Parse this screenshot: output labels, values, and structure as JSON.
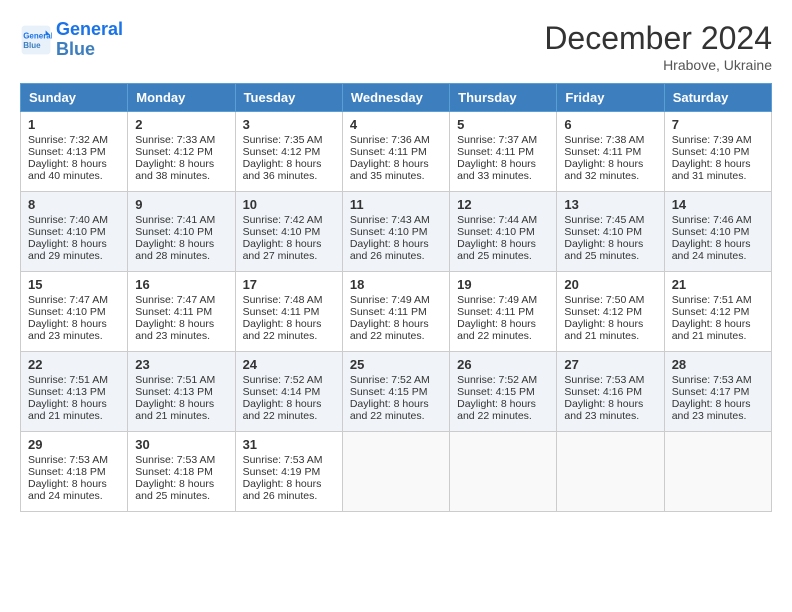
{
  "header": {
    "logo_line1": "General",
    "logo_line2": "Blue",
    "month": "December 2024",
    "location": "Hrabove, Ukraine"
  },
  "days_of_week": [
    "Sunday",
    "Monday",
    "Tuesday",
    "Wednesday",
    "Thursday",
    "Friday",
    "Saturday"
  ],
  "weeks": [
    [
      {
        "day": "1",
        "sunrise": "Sunrise: 7:32 AM",
        "sunset": "Sunset: 4:13 PM",
        "daylight": "Daylight: 8 hours and 40 minutes."
      },
      {
        "day": "2",
        "sunrise": "Sunrise: 7:33 AM",
        "sunset": "Sunset: 4:12 PM",
        "daylight": "Daylight: 8 hours and 38 minutes."
      },
      {
        "day": "3",
        "sunrise": "Sunrise: 7:35 AM",
        "sunset": "Sunset: 4:12 PM",
        "daylight": "Daylight: 8 hours and 36 minutes."
      },
      {
        "day": "4",
        "sunrise": "Sunrise: 7:36 AM",
        "sunset": "Sunset: 4:11 PM",
        "daylight": "Daylight: 8 hours and 35 minutes."
      },
      {
        "day": "5",
        "sunrise": "Sunrise: 7:37 AM",
        "sunset": "Sunset: 4:11 PM",
        "daylight": "Daylight: 8 hours and 33 minutes."
      },
      {
        "day": "6",
        "sunrise": "Sunrise: 7:38 AM",
        "sunset": "Sunset: 4:11 PM",
        "daylight": "Daylight: 8 hours and 32 minutes."
      },
      {
        "day": "7",
        "sunrise": "Sunrise: 7:39 AM",
        "sunset": "Sunset: 4:10 PM",
        "daylight": "Daylight: 8 hours and 31 minutes."
      }
    ],
    [
      {
        "day": "8",
        "sunrise": "Sunrise: 7:40 AM",
        "sunset": "Sunset: 4:10 PM",
        "daylight": "Daylight: 8 hours and 29 minutes."
      },
      {
        "day": "9",
        "sunrise": "Sunrise: 7:41 AM",
        "sunset": "Sunset: 4:10 PM",
        "daylight": "Daylight: 8 hours and 28 minutes."
      },
      {
        "day": "10",
        "sunrise": "Sunrise: 7:42 AM",
        "sunset": "Sunset: 4:10 PM",
        "daylight": "Daylight: 8 hours and 27 minutes."
      },
      {
        "day": "11",
        "sunrise": "Sunrise: 7:43 AM",
        "sunset": "Sunset: 4:10 PM",
        "daylight": "Daylight: 8 hours and 26 minutes."
      },
      {
        "day": "12",
        "sunrise": "Sunrise: 7:44 AM",
        "sunset": "Sunset: 4:10 PM",
        "daylight": "Daylight: 8 hours and 25 minutes."
      },
      {
        "day": "13",
        "sunrise": "Sunrise: 7:45 AM",
        "sunset": "Sunset: 4:10 PM",
        "daylight": "Daylight: 8 hours and 25 minutes."
      },
      {
        "day": "14",
        "sunrise": "Sunrise: 7:46 AM",
        "sunset": "Sunset: 4:10 PM",
        "daylight": "Daylight: 8 hours and 24 minutes."
      }
    ],
    [
      {
        "day": "15",
        "sunrise": "Sunrise: 7:47 AM",
        "sunset": "Sunset: 4:10 PM",
        "daylight": "Daylight: 8 hours and 23 minutes."
      },
      {
        "day": "16",
        "sunrise": "Sunrise: 7:47 AM",
        "sunset": "Sunset: 4:11 PM",
        "daylight": "Daylight: 8 hours and 23 minutes."
      },
      {
        "day": "17",
        "sunrise": "Sunrise: 7:48 AM",
        "sunset": "Sunset: 4:11 PM",
        "daylight": "Daylight: 8 hours and 22 minutes."
      },
      {
        "day": "18",
        "sunrise": "Sunrise: 7:49 AM",
        "sunset": "Sunset: 4:11 PM",
        "daylight": "Daylight: 8 hours and 22 minutes."
      },
      {
        "day": "19",
        "sunrise": "Sunrise: 7:49 AM",
        "sunset": "Sunset: 4:11 PM",
        "daylight": "Daylight: 8 hours and 22 minutes."
      },
      {
        "day": "20",
        "sunrise": "Sunrise: 7:50 AM",
        "sunset": "Sunset: 4:12 PM",
        "daylight": "Daylight: 8 hours and 21 minutes."
      },
      {
        "day": "21",
        "sunrise": "Sunrise: 7:51 AM",
        "sunset": "Sunset: 4:12 PM",
        "daylight": "Daylight: 8 hours and 21 minutes."
      }
    ],
    [
      {
        "day": "22",
        "sunrise": "Sunrise: 7:51 AM",
        "sunset": "Sunset: 4:13 PM",
        "daylight": "Daylight: 8 hours and 21 minutes."
      },
      {
        "day": "23",
        "sunrise": "Sunrise: 7:51 AM",
        "sunset": "Sunset: 4:13 PM",
        "daylight": "Daylight: 8 hours and 21 minutes."
      },
      {
        "day": "24",
        "sunrise": "Sunrise: 7:52 AM",
        "sunset": "Sunset: 4:14 PM",
        "daylight": "Daylight: 8 hours and 22 minutes."
      },
      {
        "day": "25",
        "sunrise": "Sunrise: 7:52 AM",
        "sunset": "Sunset: 4:15 PM",
        "daylight": "Daylight: 8 hours and 22 minutes."
      },
      {
        "day": "26",
        "sunrise": "Sunrise: 7:52 AM",
        "sunset": "Sunset: 4:15 PM",
        "daylight": "Daylight: 8 hours and 22 minutes."
      },
      {
        "day": "27",
        "sunrise": "Sunrise: 7:53 AM",
        "sunset": "Sunset: 4:16 PM",
        "daylight": "Daylight: 8 hours and 23 minutes."
      },
      {
        "day": "28",
        "sunrise": "Sunrise: 7:53 AM",
        "sunset": "Sunset: 4:17 PM",
        "daylight": "Daylight: 8 hours and 23 minutes."
      }
    ],
    [
      {
        "day": "29",
        "sunrise": "Sunrise: 7:53 AM",
        "sunset": "Sunset: 4:18 PM",
        "daylight": "Daylight: 8 hours and 24 minutes."
      },
      {
        "day": "30",
        "sunrise": "Sunrise: 7:53 AM",
        "sunset": "Sunset: 4:18 PM",
        "daylight": "Daylight: 8 hours and 25 minutes."
      },
      {
        "day": "31",
        "sunrise": "Sunrise: 7:53 AM",
        "sunset": "Sunset: 4:19 PM",
        "daylight": "Daylight: 8 hours and 26 minutes."
      },
      null,
      null,
      null,
      null
    ]
  ]
}
